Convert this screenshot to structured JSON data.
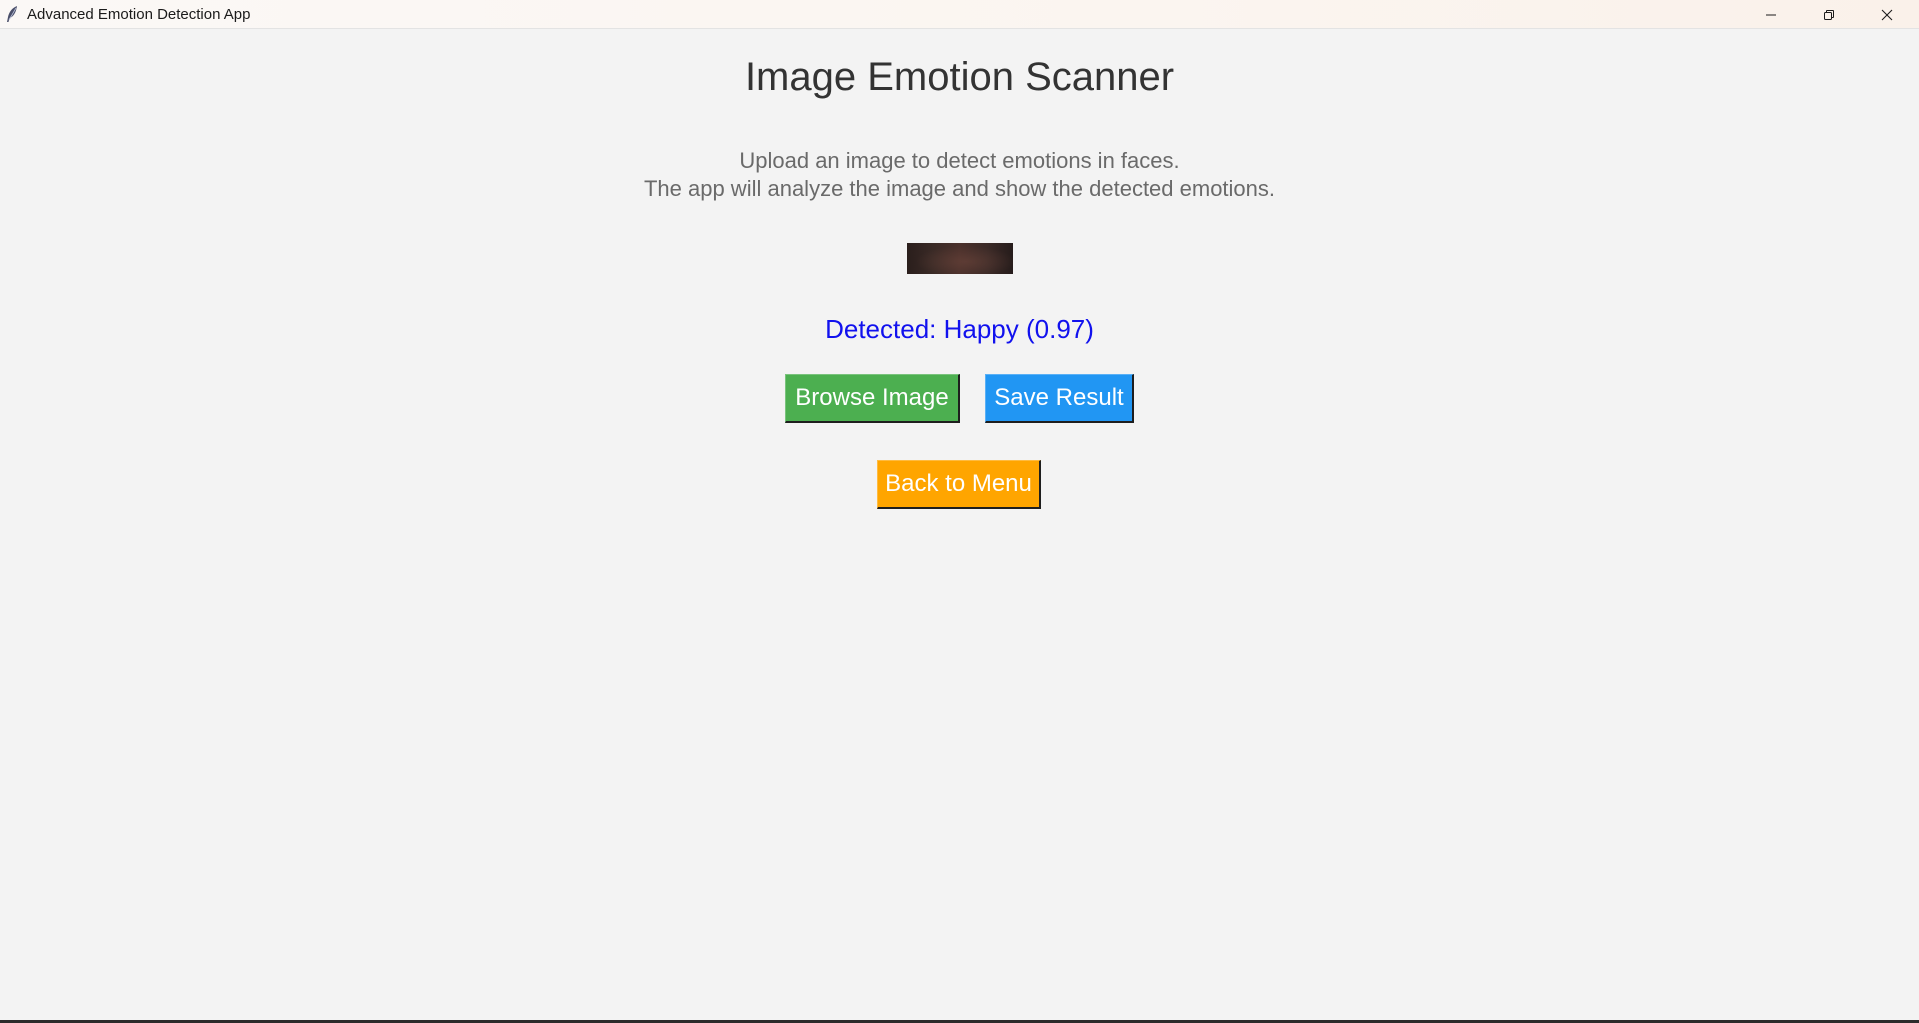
{
  "window": {
    "title": "Advanced Emotion Detection App",
    "icon": "feather-icon",
    "controls": [
      "minimize-icon",
      "restore-icon",
      "close-icon"
    ]
  },
  "main": {
    "heading": "Image Emotion Scanner",
    "description_line1": "Upload an image to detect emotions in faces.",
    "description_line2": "The app will analyze the image and show the detected emotions.",
    "result_text": "Detected: Happy (0.97)",
    "result_color": "#1111ee"
  },
  "buttons": {
    "browse_label": "Browse Image",
    "browse_color": "#4caf50",
    "save_label": "Save Result",
    "save_color": "#2196f3",
    "back_label": "Back to Menu",
    "back_color": "#ffa500"
  },
  "colors": {
    "background": "#f3f3f3",
    "heading": "#333333",
    "description": "#6a6a6a"
  }
}
